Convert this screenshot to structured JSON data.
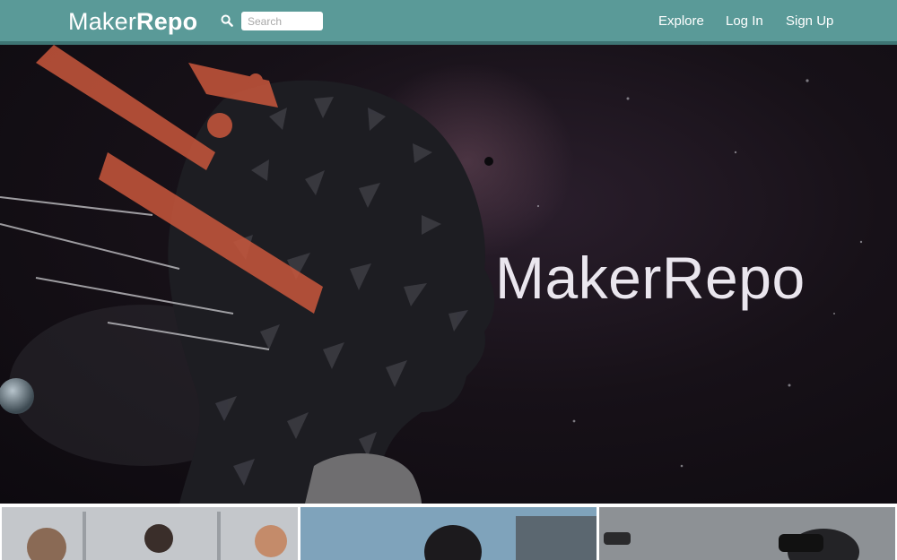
{
  "header": {
    "brand_regular": "Maker",
    "brand_bold": "Repo",
    "search_placeholder": "Search",
    "nav": [
      {
        "label": "Explore"
      },
      {
        "label": "Log In"
      },
      {
        "label": "Sign Up"
      }
    ]
  },
  "hero": {
    "title": "MakerRepo"
  },
  "icons": {
    "search": "search-icon"
  },
  "colors": {
    "header_bg": "#5a9a98",
    "header_border": "#3e7574",
    "hero_bg": "#171118",
    "accent_paint": "#c9573c"
  }
}
